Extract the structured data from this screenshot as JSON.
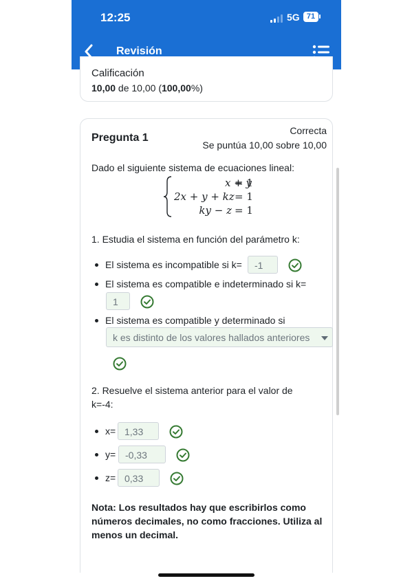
{
  "status_bar": {
    "time": "12:25",
    "network": "5G",
    "battery": "71"
  },
  "nav": {
    "title": "Revisión"
  },
  "summary": {
    "grade_label": "Calificación",
    "grade_value_bold": "10,00",
    "grade_value_mid": " de 10,00 (",
    "grade_percent_bold": "100,00",
    "grade_value_end": "%)"
  },
  "question": {
    "number": "Pregunta 1",
    "state": "Correcta",
    "grade": "Se puntúa 10,00 sobre 10,00",
    "intro": "Dado el siguiente sistema de ecuaciones lineal:",
    "equations": [
      {
        "lhs": "x + y",
        "rhs": "= 1"
      },
      {
        "lhs": "2x + y + kz",
        "rhs": "= 1"
      },
      {
        "lhs": "ky − z",
        "rhs": "= 1"
      }
    ],
    "part1": "1. Estudia el sistema en función del parámetro k:",
    "bullet1": "El sistema es incompatible si k=",
    "bullet1_answer": "-1",
    "bullet2": "El sistema es compatible e indeterminado si  k=",
    "bullet2_answer": "1",
    "bullet3": "El sistema es compatible y determinado si",
    "bullet3_select": "k es distinto de los valores hallados anteriores",
    "part2_line1": "2. Resuelve el sistema anterior para el valor de",
    "part2_line2": "k=-4:",
    "x_label": "x=",
    "x_value": "1,33",
    "y_label": "y=",
    "y_value": "-0,33",
    "z_label": "z=",
    "z_value": "0,33",
    "note": "Nota: Los resultados hay que escribirlos como números decimales, no como fracciones. Utiliza al menos un decimal."
  },
  "colors": {
    "header": "#1a6fd4",
    "correct": "#357a32",
    "input_bg": "#eef7ee"
  }
}
